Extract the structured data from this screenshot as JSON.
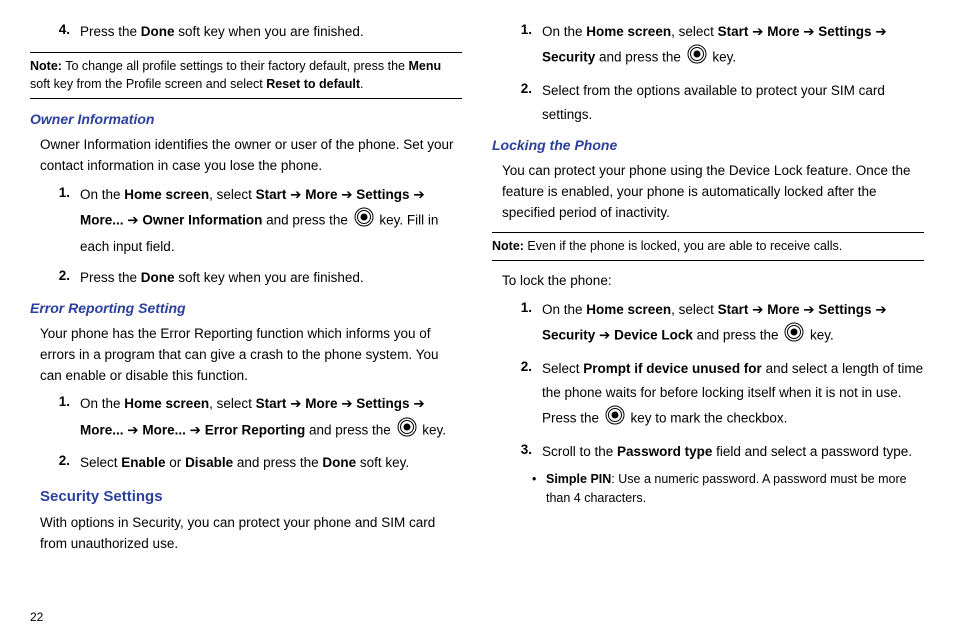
{
  "left": {
    "step4": {
      "num": "4.",
      "pre": "Press the ",
      "b1": "Done",
      "post": " soft key when you are finished."
    },
    "note1": {
      "label": "Note:",
      "pre": " To change all profile settings to their factory default, press the ",
      "b1": "Menu",
      "mid": " soft key from the Profile screen and select ",
      "b2": "Reset to default",
      "post": "."
    },
    "owner_h": "Owner Information",
    "owner_p": "Owner Information identifies the owner or user of the phone. Set your contact information in case you lose the phone.",
    "owner_s1": {
      "num": "1.",
      "pre": "On the ",
      "b1": "Home screen",
      "mid1": ", select ",
      "b2": "Start",
      "arr1": " ➔ ",
      "b3": "More",
      "arr2": " ➔ ",
      "b4": "Settings",
      "arr3": " ➔ ",
      "b5": "More...",
      "arr4": " ➔ ",
      "b6": "Owner Information",
      "mid2": " and press the ",
      "post": " key. Fill in each input field."
    },
    "owner_s2": {
      "num": "2.",
      "pre": "Press the ",
      "b1": "Done",
      "post": " soft key when you are finished."
    },
    "err_h": "Error Reporting Setting",
    "err_p": "Your phone has the Error Reporting function which informs you of errors in a program that can give a crash to the phone system. You can enable or disable this function.",
    "err_s1": {
      "num": "1.",
      "pre": "On the ",
      "b1": "Home screen",
      "mid1": ", select ",
      "b2": "Start",
      "arr1": " ➔ ",
      "b3": "More",
      "arr2": " ➔ ",
      "b4": "Settings",
      "arr3": " ➔ ",
      "b5": "More...",
      "arr4": " ➔ ",
      "b5b": "More...",
      "arr5": " ➔ ",
      "b6": "Error Reporting",
      "mid2": " and press the ",
      "post": " key."
    },
    "err_s2": {
      "num": "2.",
      "pre": "Select ",
      "b1": "Enable",
      "mid1": " or ",
      "b2": "Disable",
      "mid2": " and press the ",
      "b3": "Done",
      "post": " soft key."
    },
    "sec_h": "Security Settings",
    "sec_p": "With options in Security, you can protect your phone and SIM card from unauthorized use."
  },
  "right": {
    "s1": {
      "num": "1.",
      "pre": "On the ",
      "b1": "Home screen",
      "mid1": ", select ",
      "b2": "Start",
      "arr1": " ➔ ",
      "b3": "More",
      "arr2": " ➔ ",
      "b4": "Settings",
      "arr3": " ➔ ",
      "b5": "Security",
      "mid2": " and press the ",
      "post": " key."
    },
    "s2": {
      "num": "2.",
      "text": "Select from the options available to protect your SIM card settings."
    },
    "lock_h": "Locking the Phone",
    "lock_p": "You can protect your phone using the Device Lock feature. Once the feature is enabled, your phone is automatically locked after the specified period of inactivity.",
    "note2": {
      "label": "Note:",
      "text": " Even if the phone is locked, you are able to receive calls."
    },
    "tolock": "To lock the phone:",
    "ls1": {
      "num": "1.",
      "pre": "On the ",
      "b1": "Home screen",
      "mid1": ", select ",
      "b2": "Start",
      "arr1": " ➔ ",
      "b3": "More",
      "arr2": " ➔ ",
      "b4": "Settings",
      "arr3": " ➔ ",
      "b5": "Security",
      "arr4": " ➔ ",
      "b6": "Device Lock",
      "mid2": " and press the ",
      "post": " key."
    },
    "ls2": {
      "num": "2.",
      "pre": "Select ",
      "b1": "Prompt if device unused for",
      "mid1": " and select a length of time the phone waits for before locking itself when it is not in use. Press the ",
      "post": " key to mark the checkbox."
    },
    "ls3": {
      "num": "3.",
      "pre": "Scroll to the ",
      "b1": "Password type",
      "post": " field and select a password type."
    },
    "bul1": {
      "b1": "Simple PIN",
      "text": ": Use a numeric password. A password must be more than 4 characters."
    }
  },
  "page_number": "22"
}
